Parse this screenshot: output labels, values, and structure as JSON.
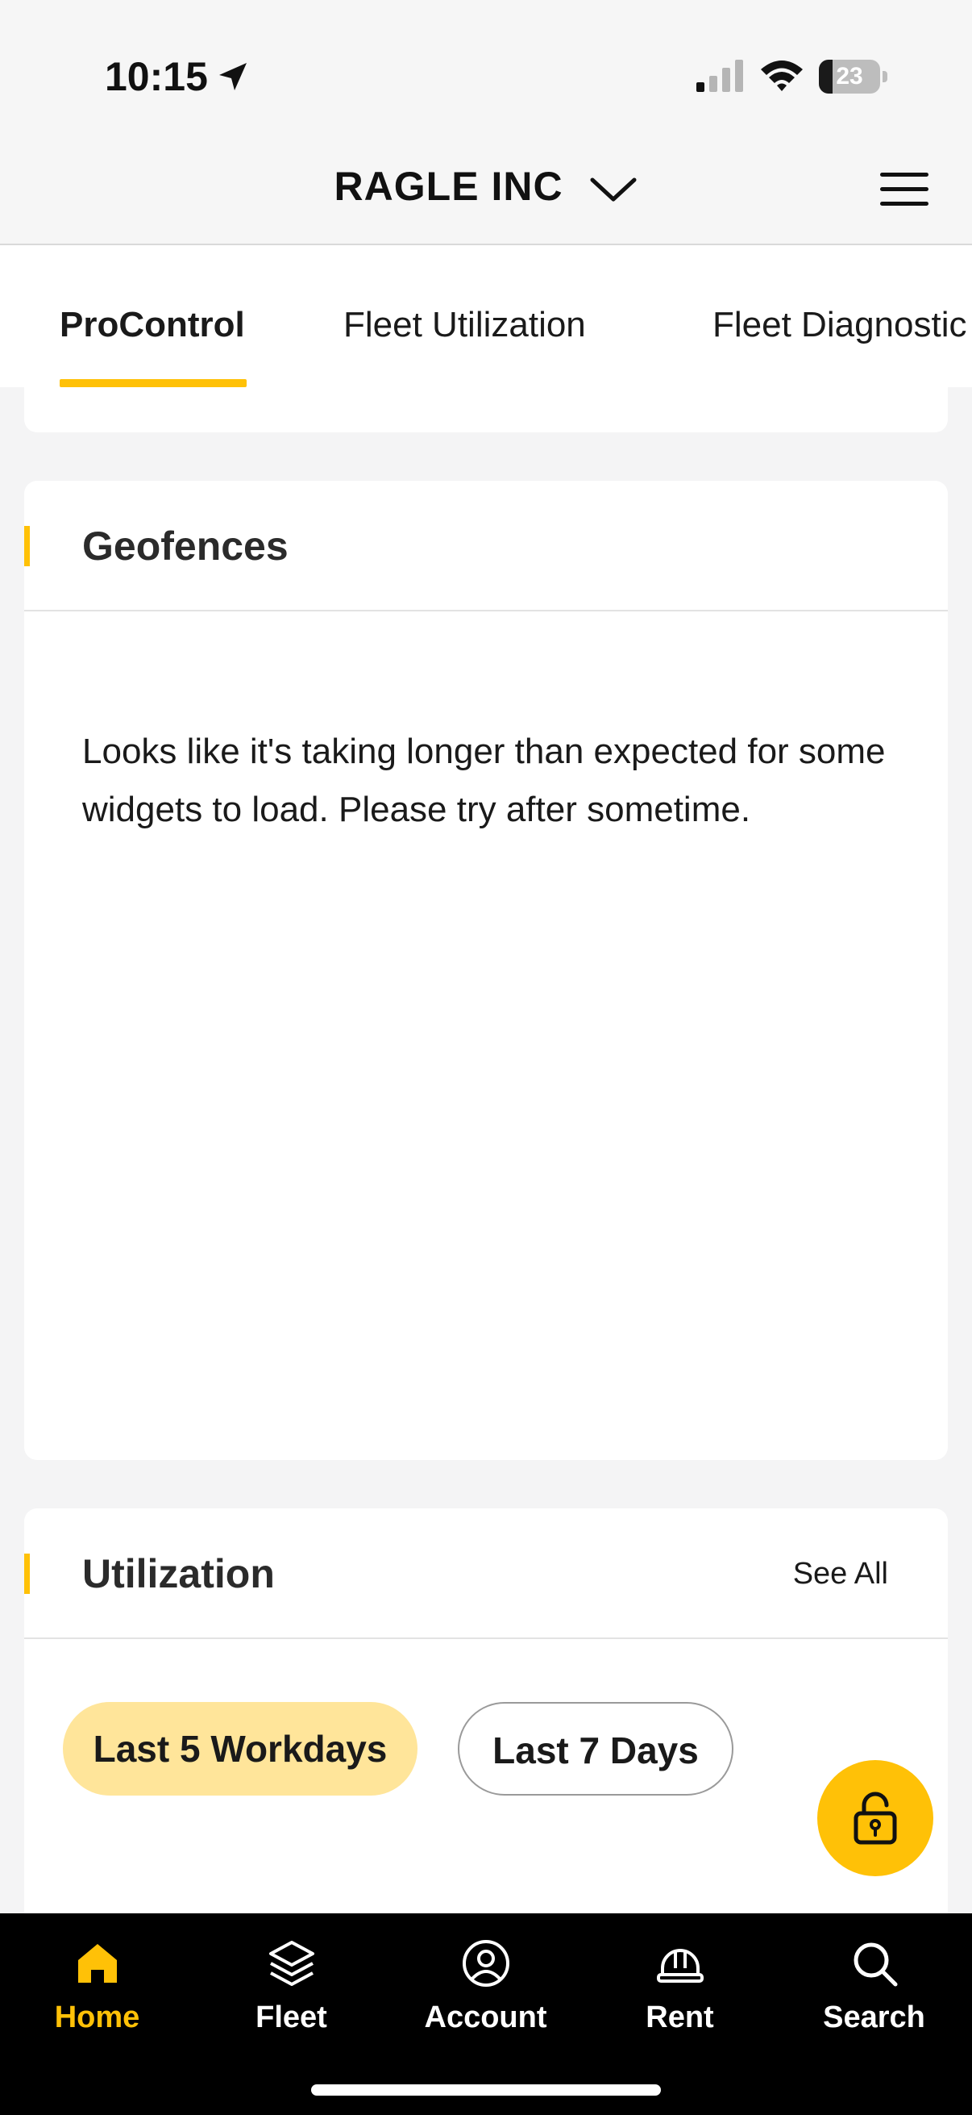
{
  "status_bar": {
    "time": "10:15",
    "battery_level": "23",
    "icons": [
      "location-arrow-icon",
      "cellular-signal-icon",
      "wifi-icon",
      "battery-icon"
    ]
  },
  "header": {
    "company_name": "RAGLE INC",
    "icons": [
      "chevron-down-icon",
      "hamburger-menu-icon"
    ]
  },
  "tabs": [
    {
      "label": "ProControl",
      "active": true
    },
    {
      "label": "Fleet Utilization",
      "active": false
    },
    {
      "label": "Fleet Diagnostic",
      "active": false
    }
  ],
  "geofences_card": {
    "title": "Geofences",
    "message": "Looks like it's taking longer than expected for some widgets to load. Please try after sometime."
  },
  "utilization_card": {
    "title": "Utilization",
    "see_all_label": "See All",
    "filters": [
      {
        "label": "Last 5 Workdays",
        "selected": true
      },
      {
        "label": "Last 7 Days",
        "selected": false
      }
    ]
  },
  "fab": {
    "icon": "unlock-icon"
  },
  "bottom_nav": [
    {
      "label": "Home",
      "icon": "home-icon",
      "active": true
    },
    {
      "label": "Fleet",
      "icon": "layers-icon",
      "active": false
    },
    {
      "label": "Account",
      "icon": "account-icon",
      "active": false
    },
    {
      "label": "Rent",
      "icon": "hardhat-icon",
      "active": false
    },
    {
      "label": "Search",
      "icon": "search-icon",
      "active": false
    }
  ],
  "colors": {
    "accent": "#ffc107",
    "chip_selected": "#ffe59a",
    "nav_background": "#000000",
    "page_background": "#f4f4f5"
  }
}
